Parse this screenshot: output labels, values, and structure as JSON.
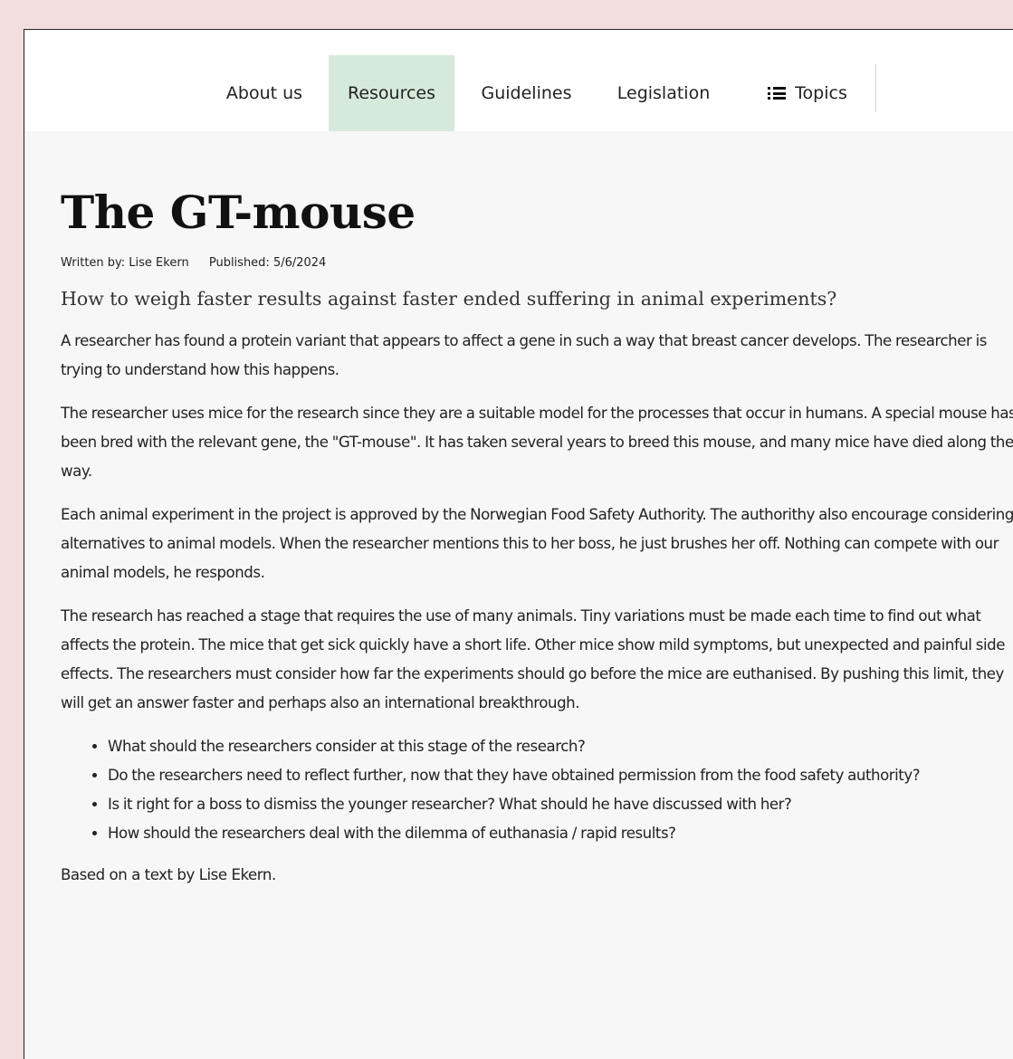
{
  "nav": {
    "items": [
      {
        "label": "About us",
        "active": false
      },
      {
        "label": "Resources",
        "active": true
      },
      {
        "label": "Guidelines",
        "active": false
      },
      {
        "label": "Legislation",
        "active": false
      }
    ],
    "topics_label": "Topics",
    "topics_icon": "list-icon",
    "active_color": "#d6eadb"
  },
  "article": {
    "title": "The GT-mouse",
    "author": "Written by: Lise Ekern",
    "published": "Published: 5/6/2024",
    "lead": "How to weigh faster results against faster ended suffering in animal experiments?",
    "paragraphs": [
      "A researcher has found a protein variant that appears to affect a gene in such a way that breast cancer develops. The researcher is trying to understand how this happens.",
      "The researcher uses mice for the research since they are a suitable model for the processes that occur in humans. A special mouse has been bred with the relevant gene, the \"GT-mouse\". It has taken several years to breed this mouse, and many mice have died along the way.",
      "Each animal experiment in the project is approved by the Norwegian Food Safety Authority. The authorithy also encourage considering alternatives to animal models. When the researcher mentions this to her boss, he just brushes her off. Nothing can compete with our animal models, he responds.",
      "The research has reached a stage that requires the use of many animals. Tiny variations must be made each time to find out what affects the protein. The mice that get sick quickly have a short life. Other mice show mild symptoms, but unexpected and painful side effects. The researchers must consider how far the experiments should go before the mice are euthanised. By pushing this limit, they will get an answer faster and perhaps also an international breakthrough."
    ],
    "questions": [
      "What should the researchers consider at this stage of the research?",
      "Do the researchers need to reflect further, now that they have obtained permission from the food safety authority?",
      "Is it right for a boss to dismiss the younger researcher? What should he have discussed with her?",
      "How should the researchers deal with the dilemma of euthanasia / rapid results?"
    ],
    "credit": "Based on a text by Lise Ekern."
  }
}
